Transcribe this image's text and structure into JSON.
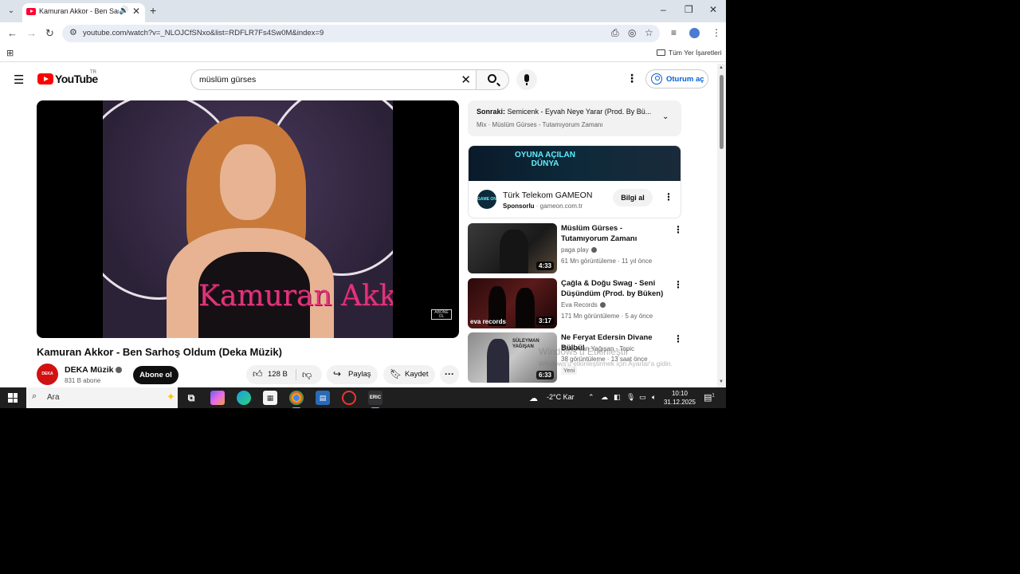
{
  "browser": {
    "tab_title": "Kamuran Akkor - Ben Sarh",
    "url": "youtube.com/watch?v=_NLOJCfSNxo&list=RDFLR7Fs4Sw0M&index=9",
    "all_bookmarks": "Tüm Yer İşaretleri"
  },
  "youtube": {
    "logo_text": "YouTube",
    "country_code": "TR",
    "search_query": "müslüm gürses",
    "signin_label": "Oturum aç"
  },
  "video": {
    "overlay_text": "Kamuran Akkor",
    "watermark": "ABONE OL",
    "title": "Kamuran Akkor - Ben Sarhoş Oldum (Deka Müzik)",
    "channel": "DEKA Müzik",
    "channel_avatar_text": "DEKA Müzik",
    "subscribers": "831 B abone",
    "subscribe_label": "Abone ol",
    "likes": "128 B",
    "share_label": "Paylaş",
    "save_label": "Kaydet"
  },
  "up_next": {
    "prefix": "Sonraki:",
    "title": "Semicenk - Eyvah Neye Yarar (Prod. By Bü...",
    "mix": "Mix · Müslüm Gürses - Tutamıyorum Zamanı"
  },
  "ad": {
    "banner_text": "OYUNA AÇILAN DÜNYA",
    "logo_text": "GAME ON",
    "name": "Türk Telekom GAMEON",
    "sponsored": "Sponsorlu",
    "domain": "gameon.com.tr",
    "cta": "Bilgi al"
  },
  "recommendations": [
    {
      "title": "Müslüm Gürses - Tutamıyorum Zamanı",
      "channel": "paga play",
      "meta": "61 Mn görüntüleme · 11 yıl önce",
      "duration": "4:33"
    },
    {
      "title": "Çağla & Doğu Swag - Seni Düşündüm (Prod. by Büken)",
      "channel": "Eva Records",
      "meta": "171 Mn görüntüleme · 5 ay önce",
      "duration": "3:17",
      "thumb_text": "eva records"
    },
    {
      "title": "Ne Feryat Edersin Divane Bülbül",
      "channel": "Süleyman Yağışan - Topic",
      "meta": "38 görüntüleme · 13 saat önce",
      "duration": "6:33",
      "badge": "Yeni",
      "thumb_text": "SÜLEYMAN YAĞIŞAN"
    }
  ],
  "windows_watermark": {
    "line1": "Windows'u Etkinleştir",
    "line2": "Windows'u etkinleştirmek için Ayarlar'a gidin."
  },
  "taskbar": {
    "search_placeholder": "Ara",
    "weather": "-2°C  Kar",
    "time": "10:10",
    "date": "31.12.2025",
    "notification_count": "1"
  }
}
